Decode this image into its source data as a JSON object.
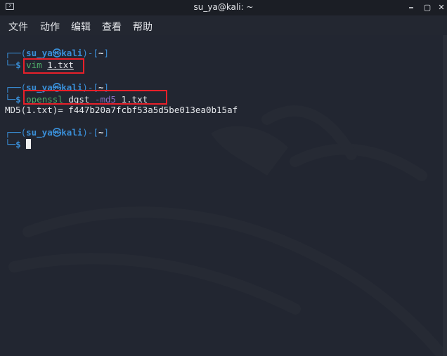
{
  "window": {
    "title": "su_ya@kali: ~",
    "icon": "terminal-icon",
    "controls": [
      "minimize-icon",
      "maximize-icon",
      "close-icon"
    ]
  },
  "menu": [
    "文件",
    "动作",
    "编辑",
    "查看",
    "帮助"
  ],
  "prompt": {
    "frame_top": "┌──(",
    "user": "su_ya",
    "at": "㉿",
    "host": "kali",
    "mid": ")-[",
    "path": "~",
    "end": "]",
    "frame_bottom": "└─",
    "dollar": "$"
  },
  "commands": [
    {
      "cmd": "vim",
      "args": [
        "1.txt"
      ]
    },
    {
      "cmd": "openssl",
      "sub": "dgst",
      "opt": "-md5",
      "args": [
        "1.txt"
      ]
    }
  ],
  "output": "MD5(1.txt)= f447b20a7fcbf53a5d5be013ea0b15af",
  "colors": {
    "background": "#222631",
    "prompt_blue": "#3a8fd8",
    "command_green": "#4fb06a",
    "option_purple": "#8a6fc4",
    "highlight_red": "#e8202a"
  }
}
